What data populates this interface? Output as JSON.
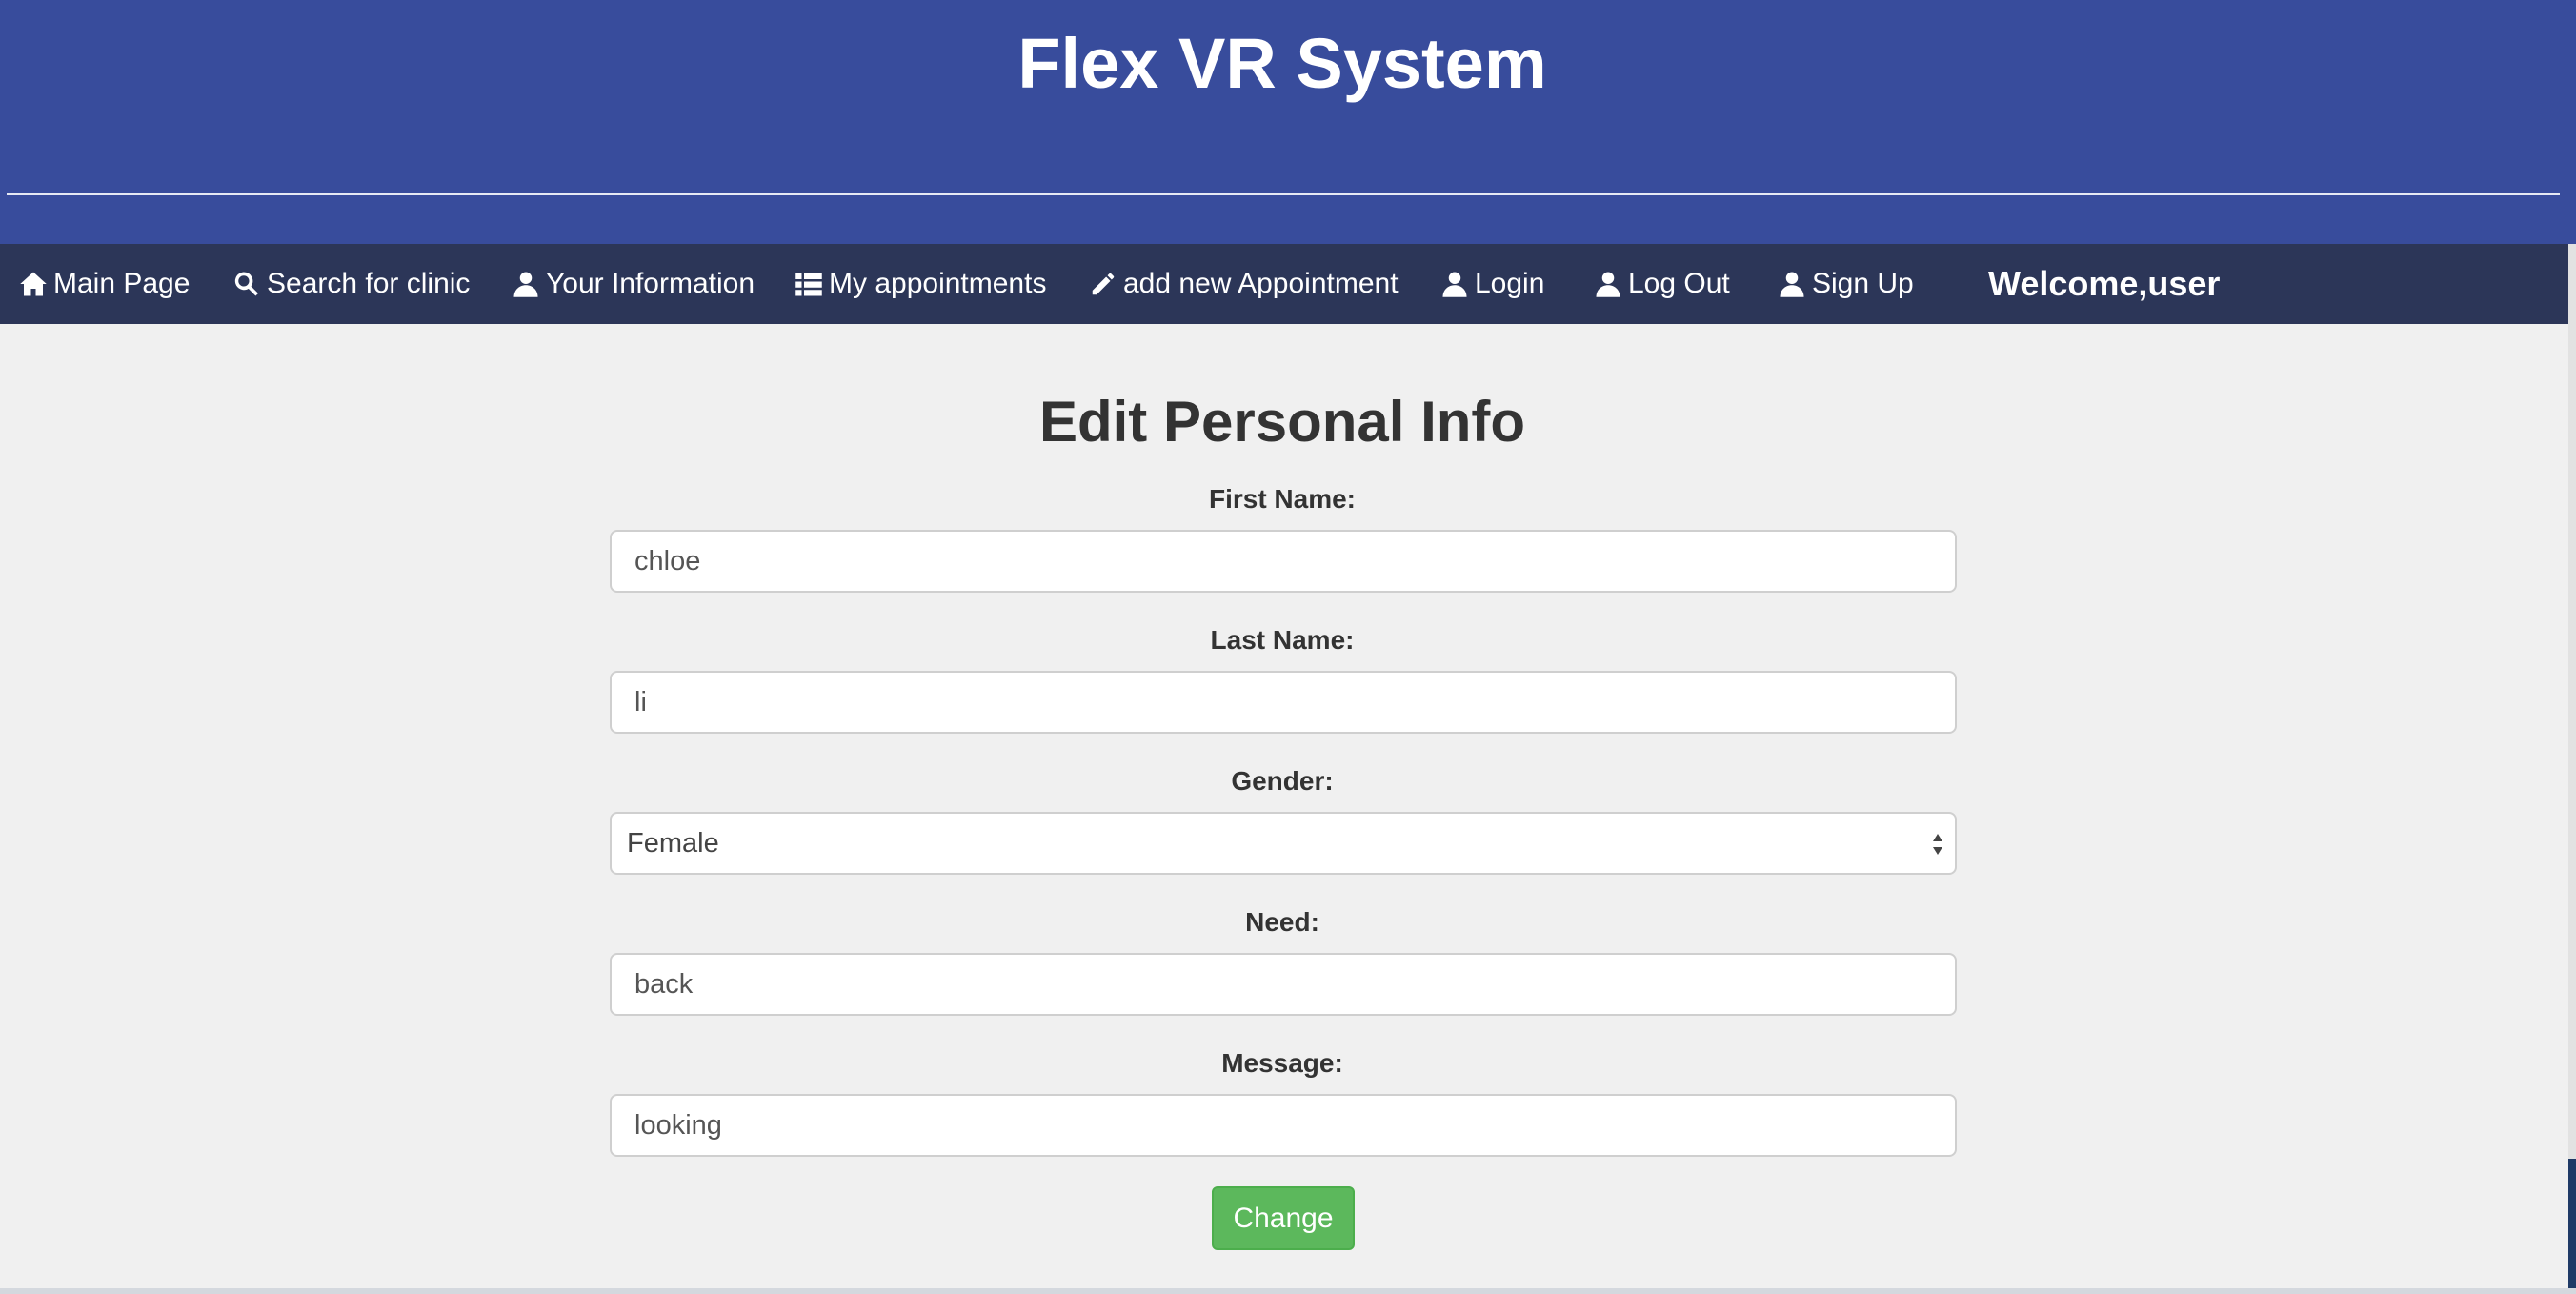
{
  "header": {
    "title": "Flex VR System"
  },
  "nav": {
    "items": [
      {
        "label": "Main Page",
        "icon": "home-icon"
      },
      {
        "label": "Search for clinic",
        "icon": "search-icon"
      },
      {
        "label": "Your Information",
        "icon": "user-icon"
      },
      {
        "label": "My appointments",
        "icon": "list-icon"
      },
      {
        "label": "add new Appointment",
        "icon": "pencil-icon"
      },
      {
        "label": "Login",
        "icon": "user-icon"
      },
      {
        "label": "Log Out",
        "icon": "user-icon"
      },
      {
        "label": "Sign Up",
        "icon": "user-icon"
      }
    ],
    "welcome": "Welcome,user"
  },
  "form": {
    "title": "Edit Personal Info",
    "first_name": {
      "label": "First Name:",
      "value": "chloe"
    },
    "last_name": {
      "label": "Last Name:",
      "value": "li"
    },
    "gender": {
      "label": "Gender:",
      "value": "Female"
    },
    "need": {
      "label": "Need:",
      "value": "back"
    },
    "message": {
      "label": "Message:",
      "value": "looking"
    },
    "submit_label": "Change"
  },
  "colors": {
    "header_bg": "#384c9c",
    "navbar_bg": "#2c3658",
    "page_bg": "#f0f0f0",
    "button_bg": "#5cb85c"
  }
}
